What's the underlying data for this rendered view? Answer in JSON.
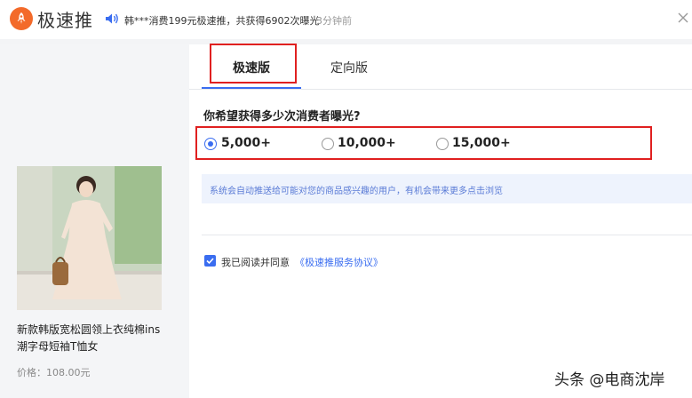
{
  "header": {
    "brand": "极速推",
    "notice": "韩***消费199元极速推，共获得6902次曝光",
    "notice_time": "3分钟前"
  },
  "product": {
    "title": "新款韩版宽松圆领上衣纯棉ins潮字母短袖T恤女",
    "price": "价格：108.00元"
  },
  "tabs": [
    {
      "label": "极速版",
      "active": true
    },
    {
      "label": "定向版",
      "active": false
    }
  ],
  "question": "你希望获得多少次消费者曝光?",
  "options": [
    {
      "label": "5,000+",
      "checked": true
    },
    {
      "label": "10,000+",
      "checked": false
    },
    {
      "label": "15,000+",
      "checked": false
    }
  ],
  "info": "系统会自动推送给可能对您的商品感兴趣的用户，有机会带来更多点击浏览",
  "agreement": {
    "text": "我已阅读并同意",
    "link": "《极速推服务协议》",
    "checked": true
  },
  "watermark": "头条 @电商沈岸",
  "colors": {
    "accent": "#3a6df0",
    "highlight_box": "#e02020",
    "logo": "#f36a2a"
  }
}
